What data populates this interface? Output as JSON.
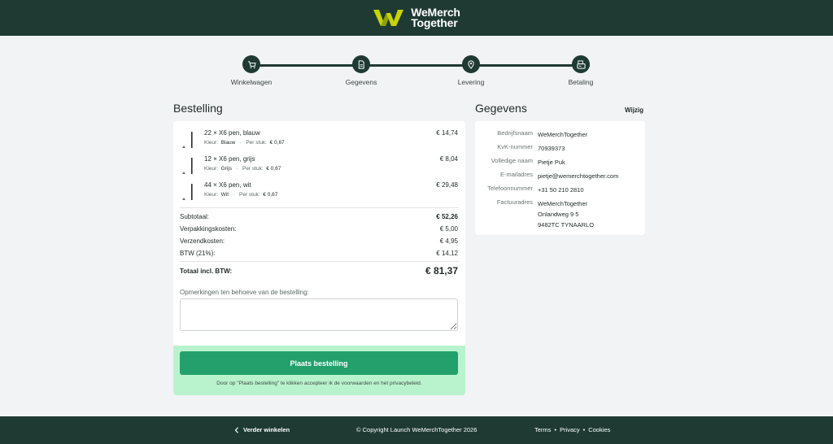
{
  "header": {
    "logo_line1": "WeMerch",
    "logo_line2": "Together",
    "brand_color": "#1e3a33",
    "logo_accent": "#c8d400"
  },
  "stepper": {
    "steps": [
      {
        "label": "Winkelwagen",
        "icon": "cart-icon"
      },
      {
        "label": "Gegevens",
        "icon": "document-icon"
      },
      {
        "label": "Levering",
        "icon": "location-pin-icon"
      },
      {
        "label": "Betaling",
        "icon": "payment-icon"
      }
    ]
  },
  "order": {
    "title": "Bestelling",
    "items": [
      {
        "name": "22 × X6 pen, blauw",
        "color_label": "Kleur:",
        "color": "Blauw",
        "separator": "·",
        "unit_label": "Per stuk:",
        "unit_price": "€ 0,67",
        "price": "€ 14,74"
      },
      {
        "name": "12 × X6 pen, grijs",
        "color_label": "Kleur:",
        "color": "Grijs",
        "separator": "·",
        "unit_label": "Per stuk:",
        "unit_price": "€ 0,67",
        "price": "€ 8,04"
      },
      {
        "name": "44 × X6 pen, wit",
        "color_label": "Kleur:",
        "color": "Wit",
        "separator": "·",
        "unit_label": "Per stuk:",
        "unit_price": "€ 0,67",
        "price": "€ 29,48"
      }
    ],
    "summary": {
      "subtotal_label": "Subtotaal:",
      "subtotal": "€ 52,26",
      "packaging_label": "Verpakkingskosten:",
      "packaging": "€ 5,00",
      "shipping_label": "Verzendkosten:",
      "shipping": "€ 4,95",
      "vat_label": "BTW (21%):",
      "vat": "€ 14,12",
      "total_label": "Totaal incl. BTW:",
      "total": "€ 81,37"
    },
    "remarks_label": "Opmerkingen ten behoeve van de bestelling:",
    "remarks_value": "",
    "place_order_label": "Plaats bestelling",
    "terms_note": "Door op \"Plaats bestelling\" te klikken accepteer ik de voorwaarden en het privacybeleid.",
    "button_color": "#23a06c",
    "action_bg": "#b9f3cd"
  },
  "details": {
    "title": "Gegevens",
    "edit_label": "Wijzig",
    "rows": [
      {
        "label": "Bedrijfsnaam",
        "value": "WeMerchTogether"
      },
      {
        "label": "KvK-nummer",
        "value": "70939373"
      },
      {
        "label": "Volledige naam",
        "value": "Pietje Puk"
      },
      {
        "label": "E-mailadres",
        "value": "pietje@wemerchtogether.com"
      },
      {
        "label": "Telefoonnummer",
        "value": "+31 50 210 2810"
      },
      {
        "label": "Factuuradres",
        "value": "WeMerchTogether",
        "value2": "Onlandweg 9 5",
        "value3": "9482TC TYNAARLO"
      }
    ]
  },
  "footer": {
    "back_label": "Verder winkelen",
    "copyright": "© Copyright Launch WeMerchTogether 2026",
    "terms": "Terms",
    "privacy": "Privacy",
    "cookies": "Cookies",
    "separator": "•"
  }
}
